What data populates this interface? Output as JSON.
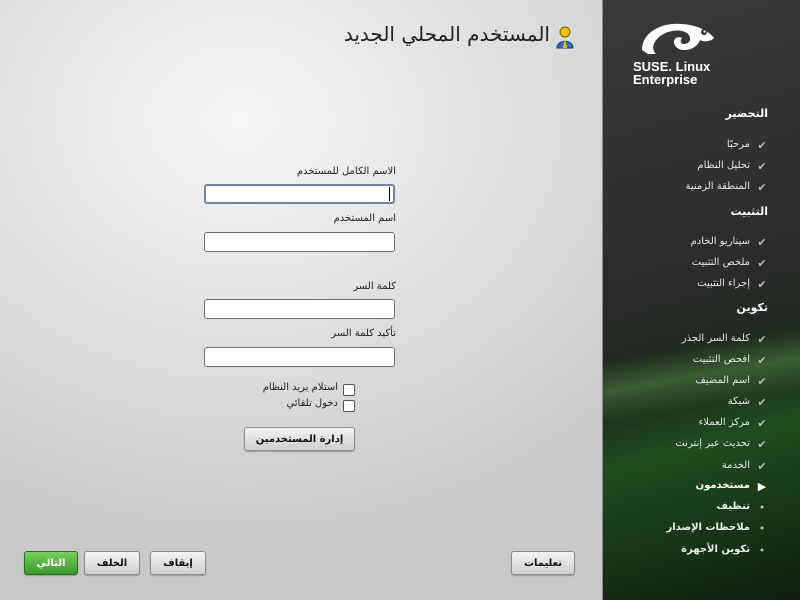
{
  "window": {
    "title": "المستخدم المحلي الجديد"
  },
  "form": {
    "full_name_label": "الاسم الكامل للمستخدم",
    "full_name_value": "",
    "username_label": "اسم المستخدم",
    "username_value": "",
    "password_label": "كلمة السر",
    "password_value": "",
    "confirm_password_label": "تأكيد كلمة السر",
    "confirm_password_value": "",
    "receive_mail_label": "استلام بريد النظام",
    "receive_mail_checked": false,
    "auto_login_label": "دخول تلقائي",
    "auto_login_checked": false,
    "user_management_button": "إدارة المستخدمين"
  },
  "buttons": {
    "help": "تعليمات",
    "abort": "إيقاف",
    "back": "الخلف",
    "next": "التالي"
  },
  "brand": {
    "line1": "SUSE. Linux",
    "line2": "Enterprise"
  },
  "sidebar": {
    "sections": [
      {
        "label": "التحضير"
      },
      {
        "label": "التثبيت"
      },
      {
        "label": "تكوين"
      }
    ],
    "steps": [
      {
        "label": "مرحبًا",
        "state": "done"
      },
      {
        "label": "تحليل النظام",
        "state": "done"
      },
      {
        "label": "المنطقة الزمنية",
        "state": "done"
      },
      {
        "label": "سيناريو الخادم",
        "state": "done"
      },
      {
        "label": "ملخص التثبيت",
        "state": "done"
      },
      {
        "label": "إجراء التثبيت",
        "state": "done"
      },
      {
        "label": "كلمة السر الجذر",
        "state": "done"
      },
      {
        "label": "افحص التثبيت",
        "state": "done"
      },
      {
        "label": "اسم المضيف",
        "state": "done"
      },
      {
        "label": "شبكة",
        "state": "done"
      },
      {
        "label": "مركز العملاء",
        "state": "done"
      },
      {
        "label": "تحديث عبر إنترنت",
        "state": "done"
      },
      {
        "label": "الخدمة",
        "state": "done"
      },
      {
        "label": "مستخدمون",
        "state": "current"
      },
      {
        "label": "تنظيف",
        "state": "todo"
      },
      {
        "label": "ملاحظات الإصدار",
        "state": "todo"
      },
      {
        "label": "تكوين الأجهزة",
        "state": "todo"
      }
    ],
    "icons": {
      "done": "check-icon",
      "current": "arrow-right-icon",
      "todo": "bullet-icon"
    }
  },
  "colors": {
    "next_button": "#3c9a2c",
    "sidebar_bg": "#2b2b2b",
    "accent_green": "#1f4d1f"
  }
}
